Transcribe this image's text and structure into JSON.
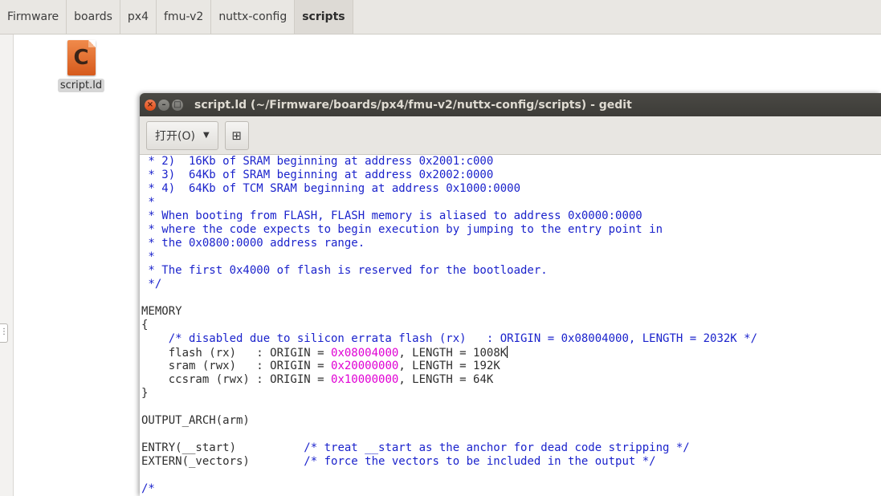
{
  "pathbar": {
    "crumbs": [
      "Firmware",
      "boards",
      "px4",
      "fmu-v2",
      "nuttx-config",
      "scripts"
    ]
  },
  "desktop_file": {
    "glyph": "C",
    "label": "script.ld"
  },
  "gedit": {
    "title": "script.ld (~/Firmware/boards/px4/fmu-v2/nuttx-config/scripts) - gedit",
    "open_label": "打开(O)",
    "new_tab_icon": "new-document-icon"
  },
  "colors": {
    "comment": "#1b23cc",
    "number": "#e000d4",
    "titlebar": "#3d3c38"
  },
  "code": {
    "l1": " * 2)  16Kb of SRAM beginning at address 0x2001:c000",
    "l2": " * 3)  64Kb of SRAM beginning at address 0x2002:0000",
    "l3": " * 4)  64Kb of TCM SRAM beginning at address 0x1000:0000",
    "l4": " *",
    "l5": " * When booting from FLASH, FLASH memory is aliased to address 0x0000:0000",
    "l6": " * where the code expects to begin execution by jumping to the entry point in",
    "l7": " * the 0x0800:0000 address range.",
    "l8": " *",
    "l9": " * The first 0x4000 of flash is reserved for the bootloader.",
    "l10": " */",
    "l12": "MEMORY",
    "l13": "{",
    "l14": "    /* disabled due to silicon errata flash (rx)   : ORIGIN = 0x08004000, LENGTH = 2032K */",
    "l15a": "    flash (rx)   : ORIGIN = ",
    "l15b": "0x08004000",
    "l15c": ", LENGTH = 1008K",
    "l16a": "    sram (rwx)   : ORIGIN = ",
    "l16b": "0x20000000",
    "l16c": ", LENGTH = 192K",
    "l17a": "    ccsram (rwx) : ORIGIN = ",
    "l17b": "0x10000000",
    "l17c": ", LENGTH = 64K",
    "l18": "}",
    "l20": "OUTPUT_ARCH(arm)",
    "l22a": "ENTRY(__start)          ",
    "l22b": "/* treat __start as the anchor for dead code stripping */",
    "l23a": "EXTERN(_vectors)        ",
    "l23b": "/* force the vectors to be included in the output */",
    "l25": "/*"
  }
}
